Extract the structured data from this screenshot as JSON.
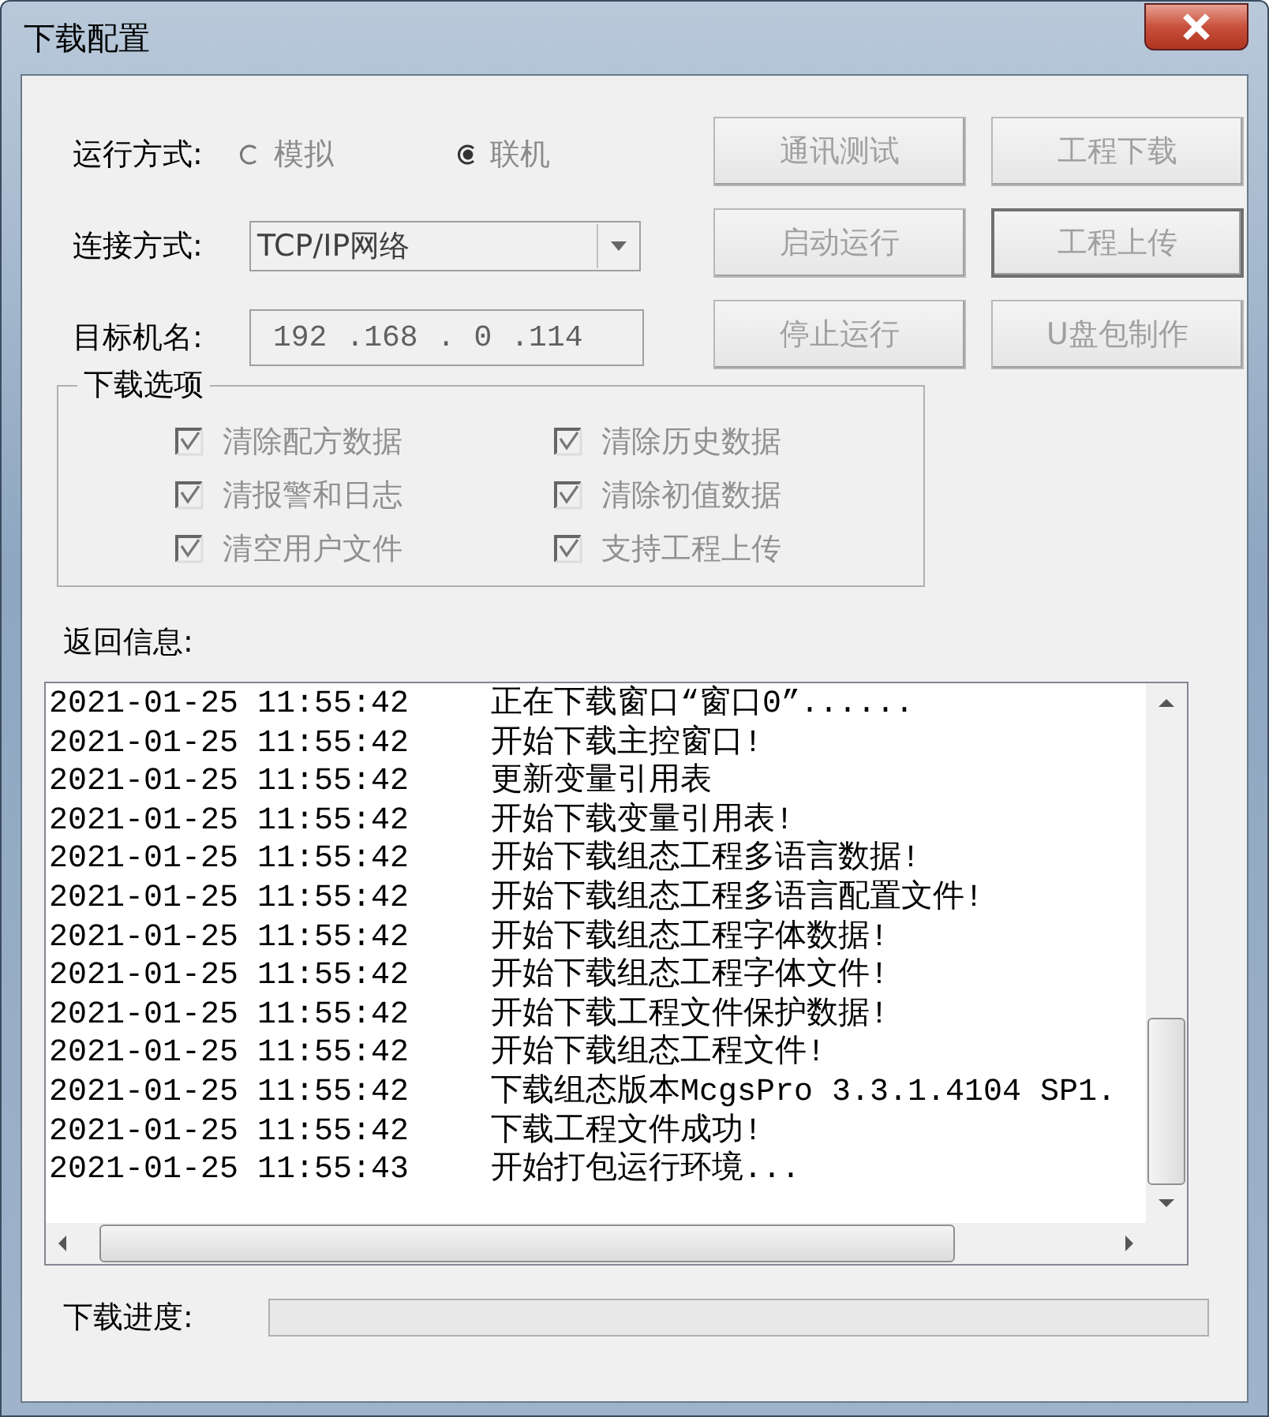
{
  "window": {
    "title": "下载配置"
  },
  "run_mode": {
    "label": "运行方式:",
    "options": [
      {
        "label": "模拟",
        "selected": false
      },
      {
        "label": "联机",
        "selected": true
      }
    ]
  },
  "connection": {
    "label": "连接方式:",
    "value": "TCP/IP网络"
  },
  "target": {
    "label": "目标机名:",
    "octets": [
      "192",
      ".168",
      ".",
      "0",
      ".114"
    ]
  },
  "buttons": [
    {
      "label": "通讯测试",
      "disabled": true,
      "focused": false
    },
    {
      "label": "工程下载",
      "disabled": true,
      "focused": false
    },
    {
      "label": "启动运行",
      "disabled": true,
      "focused": false
    },
    {
      "label": "工程上传",
      "disabled": true,
      "focused": true
    },
    {
      "label": "停止运行",
      "disabled": true,
      "focused": false
    },
    {
      "label": "U盘包制作",
      "disabled": true,
      "focused": false
    }
  ],
  "download_options": {
    "title": "下载选项",
    "items": [
      {
        "label": "清除配方数据",
        "checked": true,
        "disabled": true
      },
      {
        "label": "清除历史数据",
        "checked": true,
        "disabled": true
      },
      {
        "label": "清报警和日志",
        "checked": true,
        "disabled": true
      },
      {
        "label": "清除初值数据",
        "checked": true,
        "disabled": true
      },
      {
        "label": "清空用户文件",
        "checked": true,
        "disabled": true
      },
      {
        "label": "支持工程上传",
        "checked": true,
        "disabled": true
      }
    ]
  },
  "log": {
    "label": "返回信息:",
    "rows": [
      {
        "time": "2021-01-25 11:55:42",
        "message": "正在下载窗口“窗口0”......"
      },
      {
        "time": "2021-01-25 11:55:42",
        "message": "开始下载主控窗口!"
      },
      {
        "time": "2021-01-25 11:55:42",
        "message": "更新变量引用表"
      },
      {
        "time": "2021-01-25 11:55:42",
        "message": "开始下载变量引用表!"
      },
      {
        "time": "2021-01-25 11:55:42",
        "message": "开始下载组态工程多语言数据!"
      },
      {
        "time": "2021-01-25 11:55:42",
        "message": "开始下载组态工程多语言配置文件!"
      },
      {
        "time": "2021-01-25 11:55:42",
        "message": "开始下载组态工程字体数据!"
      },
      {
        "time": "2021-01-25 11:55:42",
        "message": "开始下载组态工程字体文件!"
      },
      {
        "time": "2021-01-25 11:55:42",
        "message": "开始下载工程文件保护数据!"
      },
      {
        "time": "2021-01-25 11:55:42",
        "message": "开始下载组态工程文件!"
      },
      {
        "time": "2021-01-25 11:55:42",
        "message": "下载组态版本McgsPro 3.3.1.4104 SP1."
      },
      {
        "time": "2021-01-25 11:55:42",
        "message": "下载工程文件成功!"
      },
      {
        "time": "2021-01-25 11:55:43",
        "message": "开始打包运行环境..."
      }
    ]
  },
  "progress": {
    "label": "下载进度:",
    "level": 0
  }
}
